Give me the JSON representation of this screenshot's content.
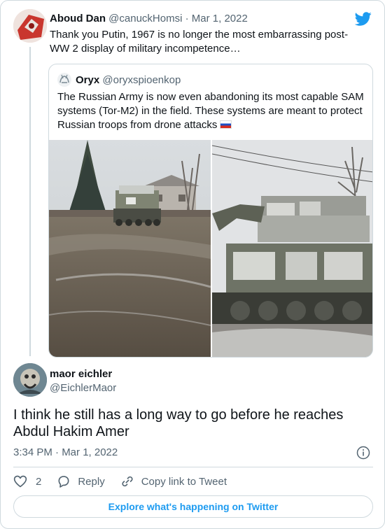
{
  "parent_tweet": {
    "author_name": "Aboud Dan",
    "author_handle": "@canuckHomsi",
    "separator": "·",
    "date": "Mar 1, 2022",
    "text": "Thank you Putin, 1967 is no longer the most embarrassing post-WW 2 display of military incompetence…"
  },
  "quoted_tweet": {
    "author_name": "Oryx",
    "author_handle": "@oryxspioenkop",
    "text": "The Russian Army is now even abandoning its most capable SAM systems (Tor-M2) in the field. These systems are meant to protect Russian troops from drone attacks",
    "flag_icon": "russia-flag-icon"
  },
  "main_tweet": {
    "author_name": "maor eichler",
    "author_handle": "@EichlerMaor",
    "text": "I think he still has a long way to go before he reaches Abdul Hakim Amer",
    "timestamp": "3:34 PM · Mar 1, 2022"
  },
  "actions": {
    "like_count": "2",
    "reply_label": "Reply",
    "copy_link_label": "Copy link to Tweet"
  },
  "explore_label": "Explore what's happening on Twitter",
  "colors": {
    "twitter_blue": "#1d9bf0",
    "text_primary": "#0f1419",
    "text_secondary": "#536471",
    "border": "#cfd9de"
  }
}
